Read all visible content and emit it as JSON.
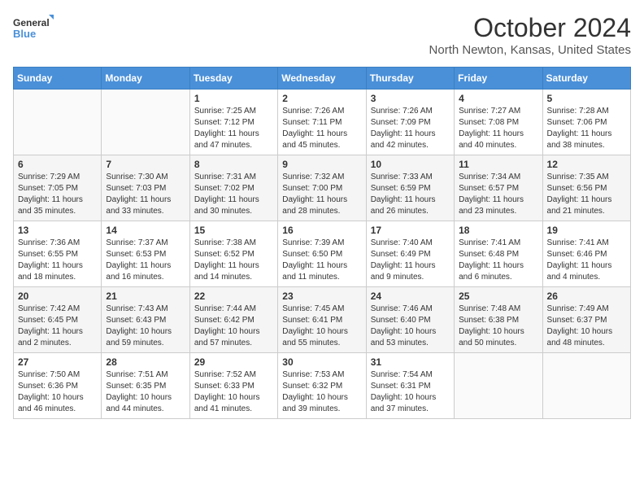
{
  "header": {
    "logo_line1": "General",
    "logo_line2": "Blue",
    "month": "October 2024",
    "location": "North Newton, Kansas, United States"
  },
  "days_of_week": [
    "Sunday",
    "Monday",
    "Tuesday",
    "Wednesday",
    "Thursday",
    "Friday",
    "Saturday"
  ],
  "weeks": [
    [
      {
        "day": null
      },
      {
        "day": null
      },
      {
        "day": "1",
        "sunrise": "Sunrise: 7:25 AM",
        "sunset": "Sunset: 7:12 PM",
        "daylight": "Daylight: 11 hours and 47 minutes."
      },
      {
        "day": "2",
        "sunrise": "Sunrise: 7:26 AM",
        "sunset": "Sunset: 7:11 PM",
        "daylight": "Daylight: 11 hours and 45 minutes."
      },
      {
        "day": "3",
        "sunrise": "Sunrise: 7:26 AM",
        "sunset": "Sunset: 7:09 PM",
        "daylight": "Daylight: 11 hours and 42 minutes."
      },
      {
        "day": "4",
        "sunrise": "Sunrise: 7:27 AM",
        "sunset": "Sunset: 7:08 PM",
        "daylight": "Daylight: 11 hours and 40 minutes."
      },
      {
        "day": "5",
        "sunrise": "Sunrise: 7:28 AM",
        "sunset": "Sunset: 7:06 PM",
        "daylight": "Daylight: 11 hours and 38 minutes."
      }
    ],
    [
      {
        "day": "6",
        "sunrise": "Sunrise: 7:29 AM",
        "sunset": "Sunset: 7:05 PM",
        "daylight": "Daylight: 11 hours and 35 minutes."
      },
      {
        "day": "7",
        "sunrise": "Sunrise: 7:30 AM",
        "sunset": "Sunset: 7:03 PM",
        "daylight": "Daylight: 11 hours and 33 minutes."
      },
      {
        "day": "8",
        "sunrise": "Sunrise: 7:31 AM",
        "sunset": "Sunset: 7:02 PM",
        "daylight": "Daylight: 11 hours and 30 minutes."
      },
      {
        "day": "9",
        "sunrise": "Sunrise: 7:32 AM",
        "sunset": "Sunset: 7:00 PM",
        "daylight": "Daylight: 11 hours and 28 minutes."
      },
      {
        "day": "10",
        "sunrise": "Sunrise: 7:33 AM",
        "sunset": "Sunset: 6:59 PM",
        "daylight": "Daylight: 11 hours and 26 minutes."
      },
      {
        "day": "11",
        "sunrise": "Sunrise: 7:34 AM",
        "sunset": "Sunset: 6:57 PM",
        "daylight": "Daylight: 11 hours and 23 minutes."
      },
      {
        "day": "12",
        "sunrise": "Sunrise: 7:35 AM",
        "sunset": "Sunset: 6:56 PM",
        "daylight": "Daylight: 11 hours and 21 minutes."
      }
    ],
    [
      {
        "day": "13",
        "sunrise": "Sunrise: 7:36 AM",
        "sunset": "Sunset: 6:55 PM",
        "daylight": "Daylight: 11 hours and 18 minutes."
      },
      {
        "day": "14",
        "sunrise": "Sunrise: 7:37 AM",
        "sunset": "Sunset: 6:53 PM",
        "daylight": "Daylight: 11 hours and 16 minutes."
      },
      {
        "day": "15",
        "sunrise": "Sunrise: 7:38 AM",
        "sunset": "Sunset: 6:52 PM",
        "daylight": "Daylight: 11 hours and 14 minutes."
      },
      {
        "day": "16",
        "sunrise": "Sunrise: 7:39 AM",
        "sunset": "Sunset: 6:50 PM",
        "daylight": "Daylight: 11 hours and 11 minutes."
      },
      {
        "day": "17",
        "sunrise": "Sunrise: 7:40 AM",
        "sunset": "Sunset: 6:49 PM",
        "daylight": "Daylight: 11 hours and 9 minutes."
      },
      {
        "day": "18",
        "sunrise": "Sunrise: 7:41 AM",
        "sunset": "Sunset: 6:48 PM",
        "daylight": "Daylight: 11 hours and 6 minutes."
      },
      {
        "day": "19",
        "sunrise": "Sunrise: 7:41 AM",
        "sunset": "Sunset: 6:46 PM",
        "daylight": "Daylight: 11 hours and 4 minutes."
      }
    ],
    [
      {
        "day": "20",
        "sunrise": "Sunrise: 7:42 AM",
        "sunset": "Sunset: 6:45 PM",
        "daylight": "Daylight: 11 hours and 2 minutes."
      },
      {
        "day": "21",
        "sunrise": "Sunrise: 7:43 AM",
        "sunset": "Sunset: 6:43 PM",
        "daylight": "Daylight: 10 hours and 59 minutes."
      },
      {
        "day": "22",
        "sunrise": "Sunrise: 7:44 AM",
        "sunset": "Sunset: 6:42 PM",
        "daylight": "Daylight: 10 hours and 57 minutes."
      },
      {
        "day": "23",
        "sunrise": "Sunrise: 7:45 AM",
        "sunset": "Sunset: 6:41 PM",
        "daylight": "Daylight: 10 hours and 55 minutes."
      },
      {
        "day": "24",
        "sunrise": "Sunrise: 7:46 AM",
        "sunset": "Sunset: 6:40 PM",
        "daylight": "Daylight: 10 hours and 53 minutes."
      },
      {
        "day": "25",
        "sunrise": "Sunrise: 7:48 AM",
        "sunset": "Sunset: 6:38 PM",
        "daylight": "Daylight: 10 hours and 50 minutes."
      },
      {
        "day": "26",
        "sunrise": "Sunrise: 7:49 AM",
        "sunset": "Sunset: 6:37 PM",
        "daylight": "Daylight: 10 hours and 48 minutes."
      }
    ],
    [
      {
        "day": "27",
        "sunrise": "Sunrise: 7:50 AM",
        "sunset": "Sunset: 6:36 PM",
        "daylight": "Daylight: 10 hours and 46 minutes."
      },
      {
        "day": "28",
        "sunrise": "Sunrise: 7:51 AM",
        "sunset": "Sunset: 6:35 PM",
        "daylight": "Daylight: 10 hours and 44 minutes."
      },
      {
        "day": "29",
        "sunrise": "Sunrise: 7:52 AM",
        "sunset": "Sunset: 6:33 PM",
        "daylight": "Daylight: 10 hours and 41 minutes."
      },
      {
        "day": "30",
        "sunrise": "Sunrise: 7:53 AM",
        "sunset": "Sunset: 6:32 PM",
        "daylight": "Daylight: 10 hours and 39 minutes."
      },
      {
        "day": "31",
        "sunrise": "Sunrise: 7:54 AM",
        "sunset": "Sunset: 6:31 PM",
        "daylight": "Daylight: 10 hours and 37 minutes."
      },
      {
        "day": null
      },
      {
        "day": null
      }
    ]
  ]
}
